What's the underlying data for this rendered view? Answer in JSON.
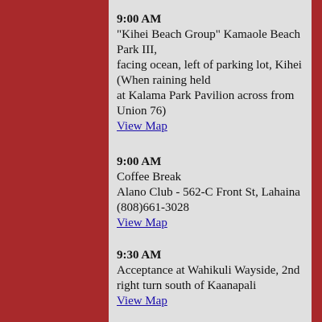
{
  "colors": {
    "background": "#a8292b",
    "panel": "#e0e0e0",
    "link": "#1a0dab"
  },
  "meetings": [
    {
      "time": "9:00 AM",
      "lines": [
        "\"Kihei Beach Group\" Kamaole Beach",
        "Park III,",
        "facing ocean, left of parking lot, Kihei",
        "(When raining held",
        "at Kalama Park Pavilion across from",
        "Union 76)"
      ],
      "link_label": "View Map"
    },
    {
      "time": "9:00 AM",
      "lines": [
        "Coffee Break",
        "Alano Club - 562-C Front St, Lahaina",
        "(808)661-3028"
      ],
      "link_label": "View Map"
    },
    {
      "time": "9:30 AM",
      "lines": [
        "Acceptance at Wahikuli Wayside, 2nd",
        "right turn south of Kaanapali"
      ],
      "link_label": "View Map"
    }
  ]
}
